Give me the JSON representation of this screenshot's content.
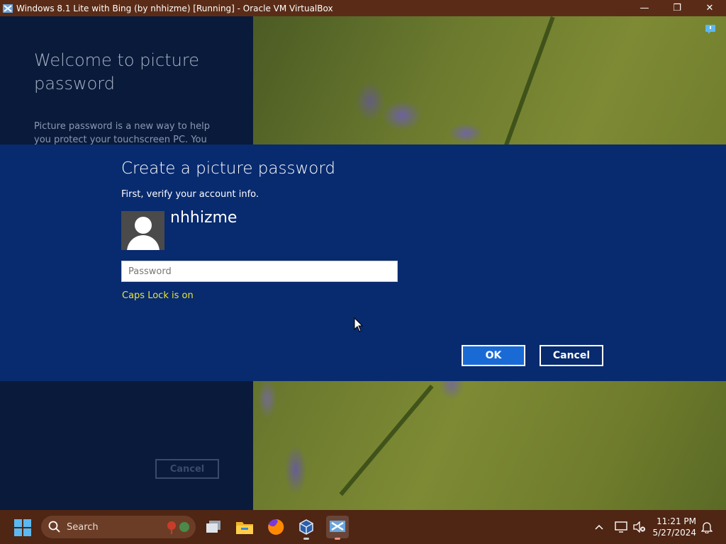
{
  "window": {
    "title": "Windows 8.1 Lite with Bing (by nhhizme) [Running] - Oracle VM VirtualBox",
    "minimize": "—",
    "restore": "❐",
    "close": "✕"
  },
  "background_page": {
    "welcome_title": "Welcome to picture password",
    "welcome_body": "Picture password is a new way to help you protect your touchscreen PC. You",
    "cancel_label": "Cancel"
  },
  "dialog": {
    "title": "Create a picture password",
    "subtitle": "First, verify your account info.",
    "username": "nhhizme",
    "password_placeholder": "Password",
    "password_value": "",
    "caps_lock_warning": "Caps Lock is on",
    "ok_label": "OK",
    "cancel_label": "Cancel"
  },
  "taskbar": {
    "search_label": "Search",
    "time": "11:21 PM",
    "date": "5/27/2024",
    "apps": [
      "task-view",
      "file-explorer",
      "firefox",
      "virtualbox",
      "virtualbox-vm"
    ]
  },
  "colors": {
    "dialog_bg": "#082a6e",
    "accent_button": "#1a6ad6",
    "caps_warning": "#e6e63c",
    "taskbar_bg": "#4f2514"
  }
}
